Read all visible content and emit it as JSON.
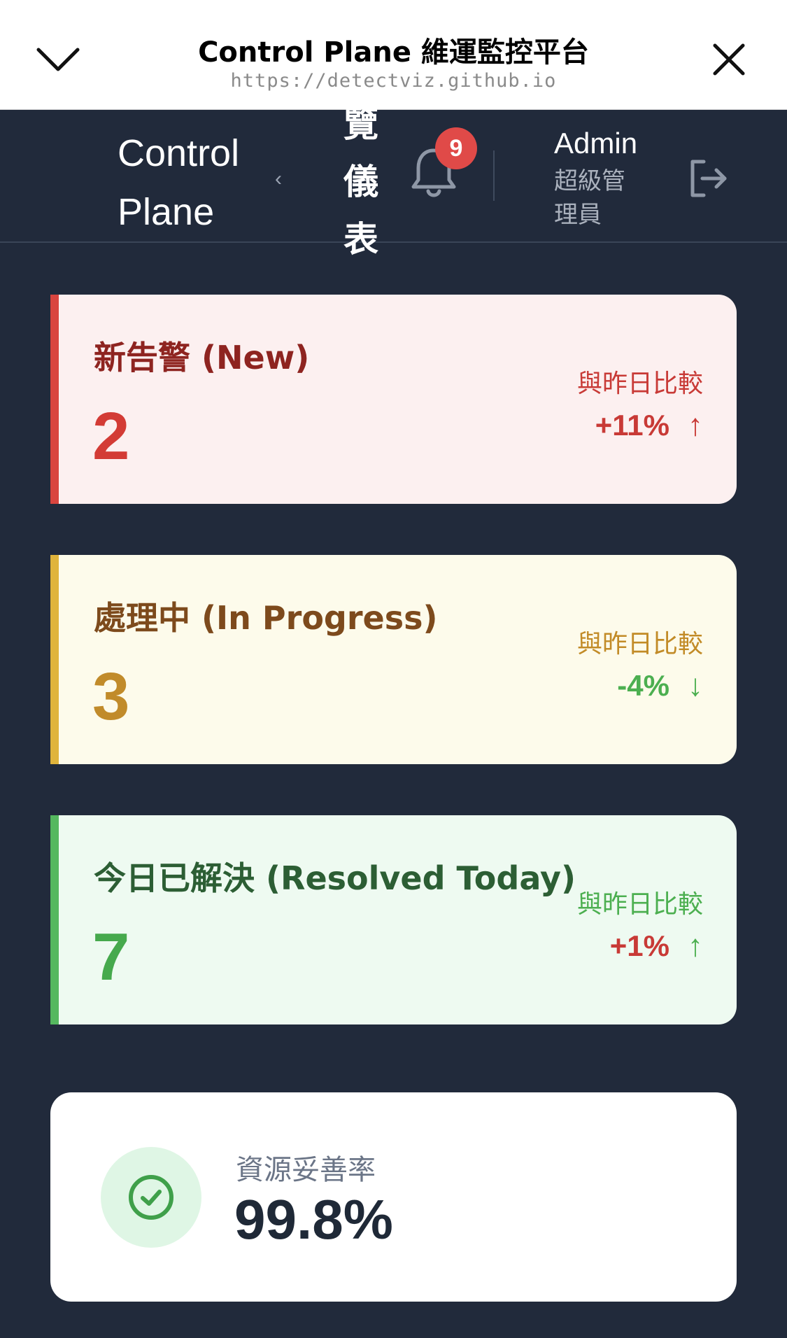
{
  "browser": {
    "title": "Control Plane 維運監控平台",
    "url": "https://detectviz.github.io",
    "collapse_icon": "chevron-down-icon",
    "close_icon": "close-icon"
  },
  "header": {
    "brand": "Control Plane",
    "collapse_arrow": "‹",
    "page_title": "覽儀表板",
    "notifications_count": "9",
    "user_name": "Admin",
    "user_role": "超級管理員"
  },
  "cards": {
    "new": {
      "label": "新告警 (New)",
      "value": "2",
      "compare_label": "與昨日比較",
      "delta": "+11%",
      "arrow": "↑"
    },
    "in_progress": {
      "label": "處理中 (In Progress)",
      "value": "3",
      "compare_label": "與昨日比較",
      "delta": "-4%",
      "arrow": "↓"
    },
    "resolved": {
      "label": "今日已解決 (Resolved Today)",
      "value": "7",
      "compare_label": "與昨日比較",
      "delta": "+1%",
      "arrow": "↑"
    }
  },
  "resource": {
    "label": "資源妥善率",
    "value": "99.8%"
  },
  "colors": {
    "background": "#212a3b",
    "new_accent": "#d9453f",
    "progress_accent": "#e0b43c",
    "resolved_accent": "#55b85f",
    "badge": "#e04a48"
  }
}
